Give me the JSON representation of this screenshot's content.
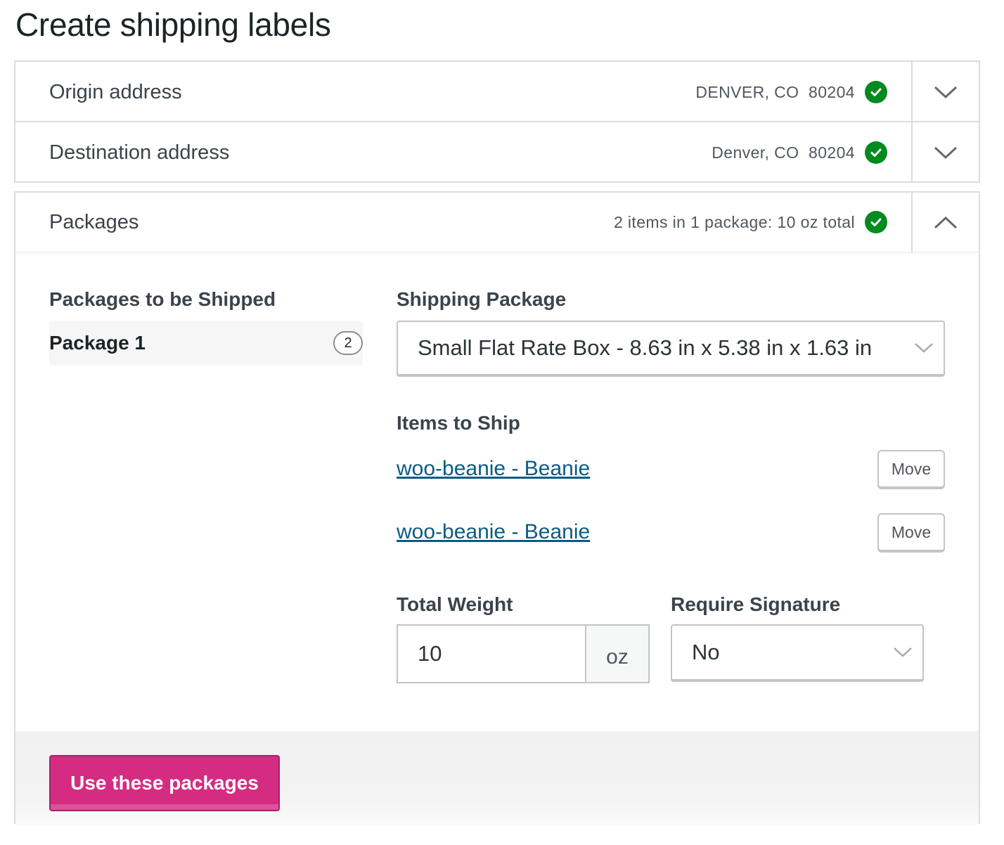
{
  "page": {
    "title": "Create shipping labels"
  },
  "origin": {
    "title": "Origin address",
    "summary": "DENVER, CO  80204",
    "status_icon": "check-circle-icon",
    "toggle_icon": "chevron-down-icon"
  },
  "destination": {
    "title": "Destination address",
    "summary": "Denver, CO  80204",
    "status_icon": "check-circle-icon",
    "toggle_icon": "chevron-down-icon"
  },
  "packages": {
    "title": "Packages",
    "summary": "2 items in 1 package: 10 oz total",
    "status_icon": "check-circle-icon",
    "toggle_icon": "chevron-up-icon",
    "to_be_shipped_label": "Packages to be Shipped",
    "list": [
      {
        "label": "Package 1",
        "count": "2"
      }
    ],
    "shipping_package_label": "Shipping Package",
    "shipping_package_value": "Small Flat Rate Box - 8.63 in x 5.38 in x 1.63 in",
    "items_label": "Items to Ship",
    "items": [
      {
        "name": "woo-beanie - Beanie",
        "action": "Move"
      },
      {
        "name": "woo-beanie - Beanie",
        "action": "Move"
      }
    ],
    "total_weight_label": "Total Weight",
    "total_weight_value": "10",
    "weight_unit": "oz",
    "signature_label": "Require Signature",
    "signature_value": "No",
    "submit_label": "Use these packages"
  },
  "colors": {
    "success": "#008a20",
    "primary": "#d52c82",
    "link": "#0a5b85",
    "border": "#dcdcde"
  }
}
